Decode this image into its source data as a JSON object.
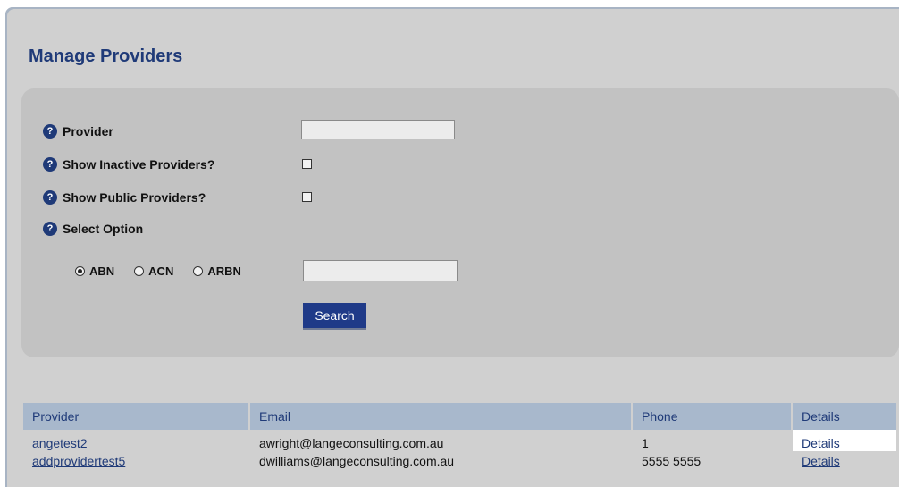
{
  "page": {
    "title": "Manage Providers"
  },
  "search": {
    "fields": [
      {
        "label": "Provider",
        "value": ""
      },
      {
        "label": "Show Inactive Providers?",
        "checked": false
      },
      {
        "label": "Show Public Providers?",
        "checked": false
      },
      {
        "label": "Select Option"
      }
    ],
    "options": [
      {
        "label": "ABN",
        "selected": true
      },
      {
        "label": "ACN",
        "selected": false
      },
      {
        "label": "ARBN",
        "selected": false
      }
    ],
    "option_value": "",
    "button_label": "Search"
  },
  "results": {
    "columns": [
      "Provider",
      "Email",
      "Phone",
      "Details"
    ],
    "rows": [
      {
        "provider": "angetest2",
        "email": "awright@langeconsulting.com.au",
        "phone": "1",
        "details": "Details"
      },
      {
        "provider": "addprovidertest5",
        "email": "dwilliams@langeconsulting.com.au",
        "phone": "5555 5555",
        "details": "Details"
      }
    ]
  },
  "colors": {
    "accent": "#1f3a78",
    "button": "#1f3a88",
    "header": "#a8b8cc",
    "panel": "#c2c2c2",
    "background": "#d0d0d0"
  },
  "icons": {
    "help": "question-circle-icon"
  }
}
